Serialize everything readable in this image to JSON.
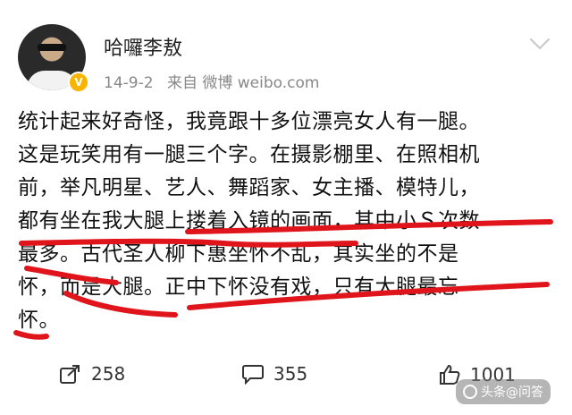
{
  "user": {
    "name": "哈囉李敖",
    "badge": "V"
  },
  "meta": {
    "date": "14-9-2",
    "source": "来自 微博 weibo.com"
  },
  "post": {
    "lines": [
      "统计起来好奇怪，我竟跟十多位漂亮女人有一腿。",
      "这是玩笑用有一腿三个字。在摄影棚里、在照相机",
      "前，举凡明星、艺人、舞蹈家、女主播、模特儿，",
      "都有坐在我大腿上搂着入镜的画面，其中小Ｓ次数",
      "最多。古代圣人柳下惠坐怀不乱，其实坐的不是",
      "怀，而是大腿。正中下怀没有戏，只有大腿最忘",
      "怀。"
    ]
  },
  "actions": {
    "repost_count": "258",
    "comment_count": "355",
    "like_count": "1001"
  },
  "annotation_color": "#e0151b",
  "watermark": "头条@问答"
}
